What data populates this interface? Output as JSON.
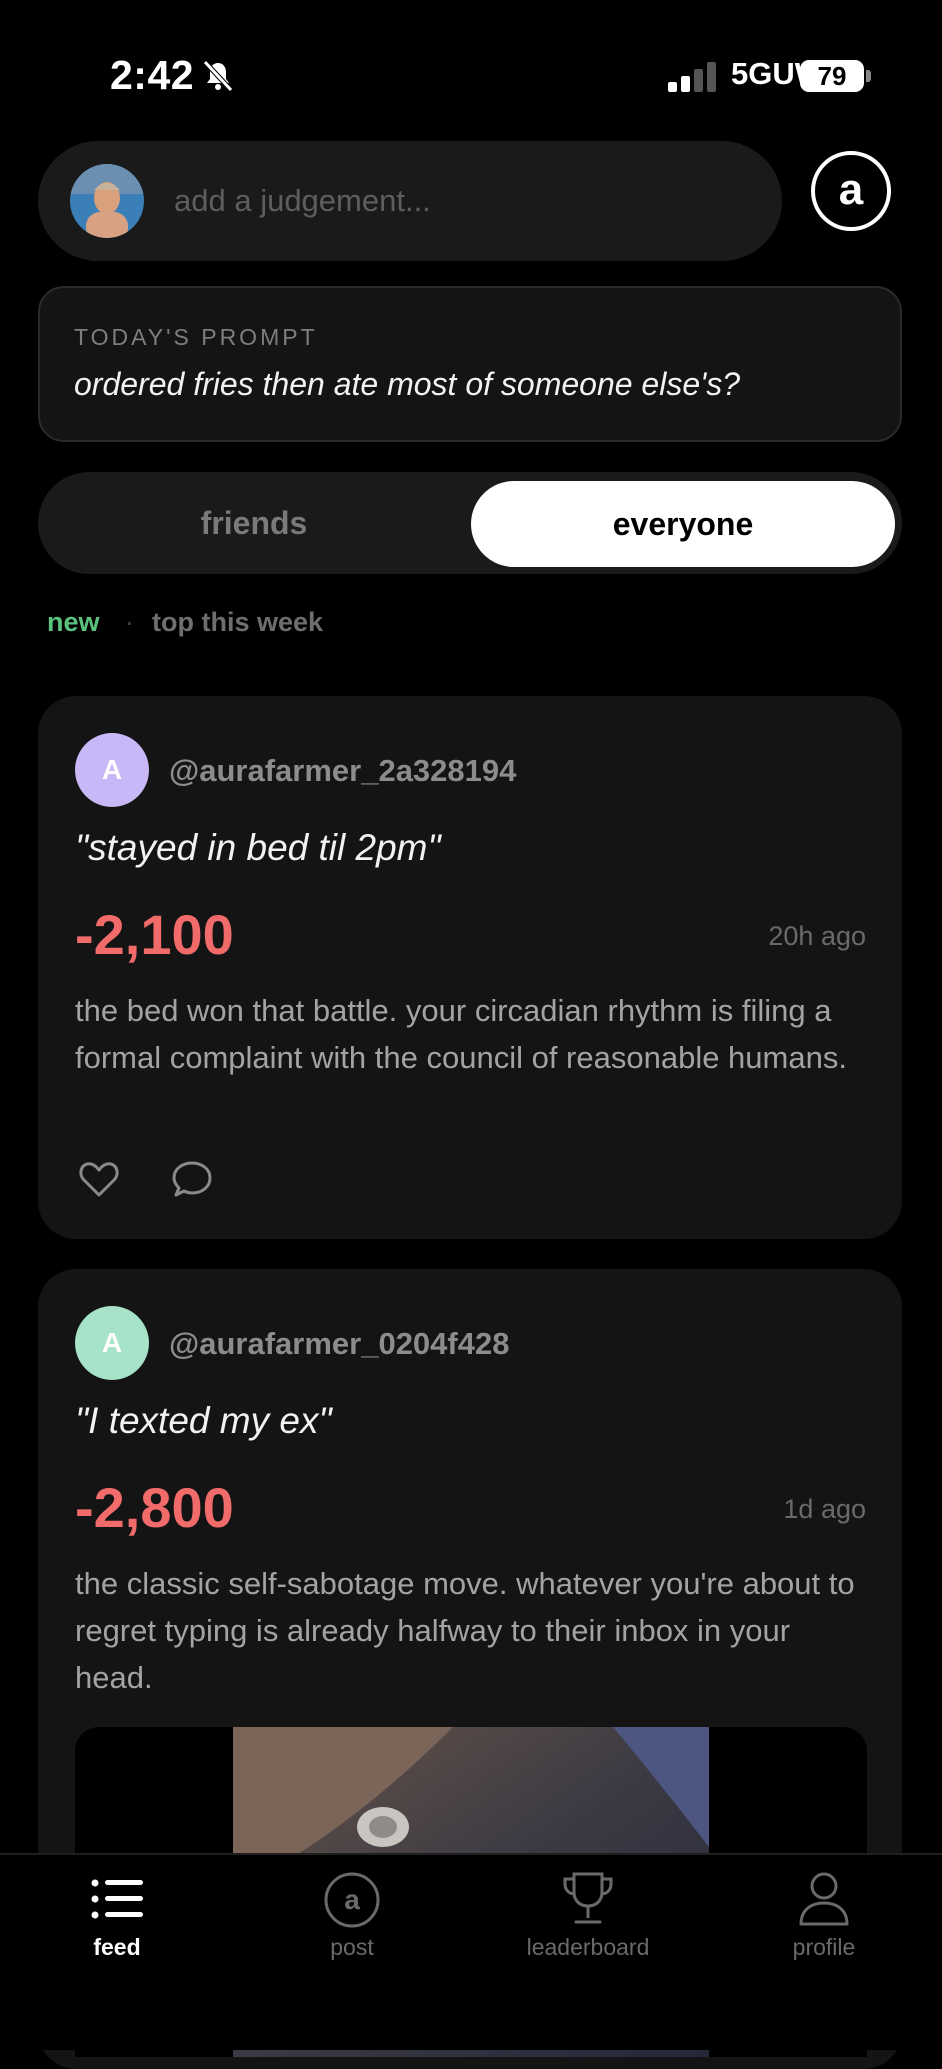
{
  "status_bar": {
    "time": "2:42",
    "network": "5GUW",
    "battery": "79"
  },
  "composer": {
    "placeholder": "add a judgement...",
    "logo_letter": "a"
  },
  "prompt": {
    "label": "TODAY'S PROMPT",
    "text": "ordered fries then ate most of someone else's?"
  },
  "segments": {
    "friends": "friends",
    "everyone": "everyone",
    "selected": "everyone"
  },
  "filters": {
    "new": "new",
    "separator": "·",
    "top": "top this week",
    "selected": "new"
  },
  "posts": [
    {
      "avatar_letter": "A",
      "avatar_color": "#c9b8f7",
      "username": "@aurafarmer_2a328194",
      "quote": "\"stayed in bed til 2pm\"",
      "score": "-2,100",
      "ago": "20h ago",
      "body": "the bed won that battle. your circadian rhythm is filing a formal complaint with the council of reasonable humans."
    },
    {
      "avatar_letter": "A",
      "avatar_color": "#a6e3c8",
      "username": "@aurafarmer_0204f428",
      "quote": "\"I texted my ex\"",
      "score": "-2,800",
      "ago": "1d ago",
      "body": "the classic self-sabotage move. whatever you're about to regret typing is already halfway to their inbox in your head."
    }
  ],
  "tabs": [
    {
      "label": "feed",
      "icon": "list-icon"
    },
    {
      "label": "post",
      "icon": "post-a-icon"
    },
    {
      "label": "leaderboard",
      "icon": "trophy-icon"
    },
    {
      "label": "profile",
      "icon": "person-icon"
    }
  ],
  "colors": {
    "score": "#f26b6b",
    "accent_green": "#5ac27c",
    "background": "#000000"
  }
}
